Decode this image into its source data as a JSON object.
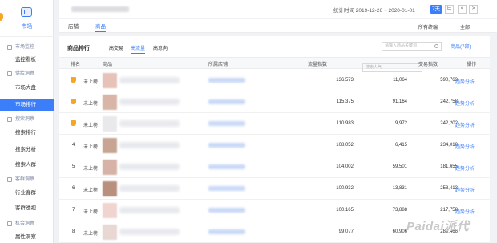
{
  "sidebar": {
    "brand_label": "市场",
    "sections": [
      {
        "label": "市场监控",
        "items": [
          {
            "label": "监控看板",
            "active": false
          }
        ]
      },
      {
        "label": "供给洞察",
        "items": [
          {
            "label": "市场大盘",
            "active": false
          },
          {
            "label": "市场排行",
            "active": true
          }
        ]
      },
      {
        "label": "搜索洞察",
        "items": [
          {
            "label": "搜索排行",
            "active": false
          },
          {
            "label": "搜索分析",
            "active": false
          },
          {
            "label": "搜索人群",
            "active": false
          }
        ]
      },
      {
        "label": "客群洞察",
        "items": [
          {
            "label": "行业客群",
            "active": false
          },
          {
            "label": "客群透视",
            "active": false
          }
        ]
      },
      {
        "label": "机会洞察",
        "items": [
          {
            "label": "属性洞察",
            "active": false
          }
        ]
      }
    ]
  },
  "header": {
    "stat_time": "统计时间 2019-12-26 ~ 2020-01-01",
    "range_button": "7天",
    "calendar_icon": "calendar-icon",
    "prev_label": "<",
    "next_label": ">"
  },
  "tabs": {
    "shop": "店铺",
    "goods": "商品",
    "terminal": "所有终端",
    "all": "全部"
  },
  "panel": {
    "title": "商品排行",
    "subtabs": [
      "高交易",
      "高流量",
      "高意向"
    ],
    "search_placeholder": "请输入商品关键词",
    "compare": "商品(7部)"
  },
  "table": {
    "headers": {
      "rank": "排名",
      "goods": "商品",
      "shop": "所属店铺",
      "flow": "流量指数",
      "search": "搜索人气",
      "trade": "交易指数",
      "op": "操作"
    },
    "rows": [
      {
        "rank": "",
        "crown": true,
        "status": "未上榜",
        "flow": "136,573",
        "search": "11,064",
        "trade": "590,763",
        "action": "趋势分析"
      },
      {
        "rank": "",
        "crown": true,
        "status": "未上榜",
        "flow": "115,375",
        "search": "91,164",
        "trade": "242,758",
        "action": "趋势分析"
      },
      {
        "rank": "",
        "crown": true,
        "status": "未上榜",
        "flow": "110,983",
        "search": "9,972",
        "trade": "242,202",
        "action": "趋势分析"
      },
      {
        "rank": "4",
        "crown": false,
        "status": "未上榜",
        "flow": "108,052",
        "search": "6,415",
        "trade": "234,010",
        "action": "趋势分析"
      },
      {
        "rank": "5",
        "crown": false,
        "status": "未上榜",
        "flow": "104,002",
        "search": "59,501",
        "trade": "181,655",
        "action": "趋势分析"
      },
      {
        "rank": "6",
        "crown": false,
        "status": "未上榜",
        "flow": "100,932",
        "search": "13,831",
        "trade": "258,413",
        "action": "趋势分析"
      },
      {
        "rank": "7",
        "crown": false,
        "status": "未上榜",
        "flow": "100,165",
        "search": "73,888",
        "trade": "217,758",
        "action": "趋势分析"
      },
      {
        "rank": "8",
        "crown": false,
        "status": "未上榜",
        "flow": "99,077",
        "search": "60,906",
        "trade": "289,466",
        "action": ""
      }
    ]
  },
  "watermark": "Paidai派代"
}
